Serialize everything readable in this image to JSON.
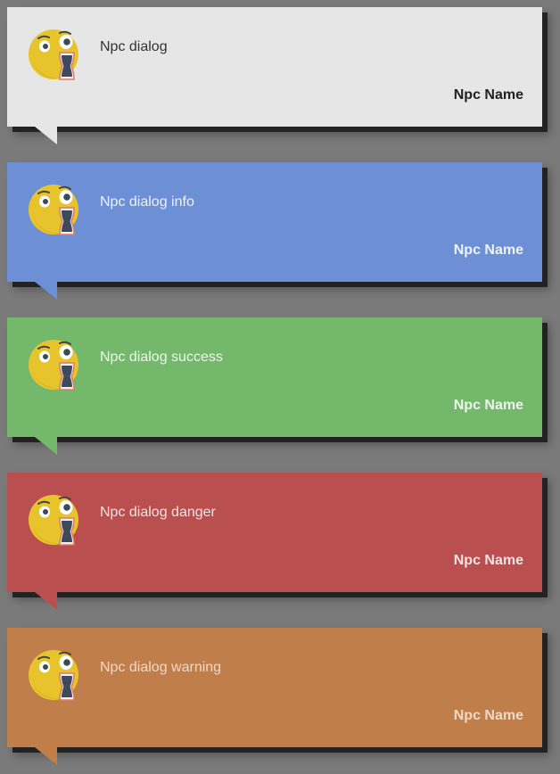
{
  "dialogs": [
    {
      "variant": "default",
      "message": "Npc dialog",
      "npc_name": "Npc Name",
      "avatar_icon": "shocked-face-icon"
    },
    {
      "variant": "info",
      "message": "Npc dialog info",
      "npc_name": "Npc Name",
      "avatar_icon": "shocked-face-icon"
    },
    {
      "variant": "success",
      "message": "Npc dialog success",
      "npc_name": "Npc Name",
      "avatar_icon": "shocked-face-icon"
    },
    {
      "variant": "danger",
      "message": "Npc dialog danger",
      "npc_name": "Npc Name",
      "avatar_icon": "shocked-face-icon"
    },
    {
      "variant": "warning",
      "message": "Npc dialog warning",
      "npc_name": "Npc Name",
      "avatar_icon": "shocked-face-icon"
    }
  ],
  "colors": {
    "page_background": "#7a7a7a",
    "default": "#e6e6e6",
    "info": "#6d8fd6",
    "success": "#74b86c",
    "danger": "#b94f4f",
    "warning": "#c07e4a"
  }
}
